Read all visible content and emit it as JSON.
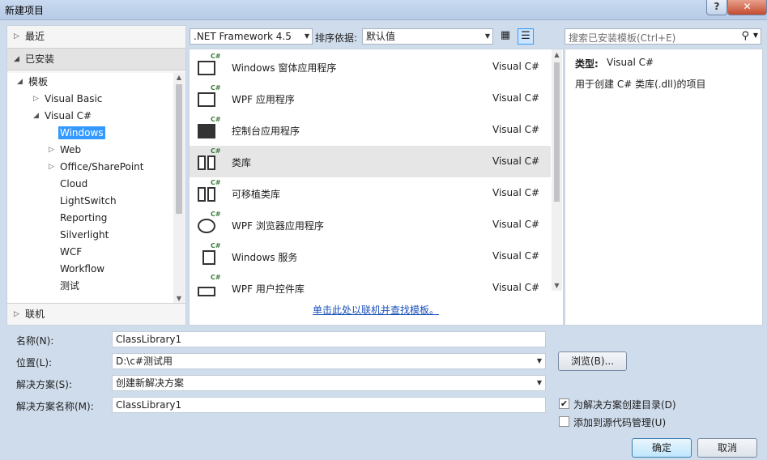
{
  "window": {
    "title": "新建项目",
    "help": "?",
    "close": "✕"
  },
  "sidebar": {
    "recent": "最近",
    "installed": "已安装",
    "online": "联机",
    "tree": [
      {
        "label": "模板",
        "toggle": "◢"
      },
      {
        "label": "Visual Basic",
        "toggle": "▷"
      },
      {
        "label": "Visual C#",
        "toggle": "◢"
      },
      {
        "label": "Windows",
        "selected": true
      },
      {
        "label": "Web",
        "toggle": "▷"
      },
      {
        "label": "Office/SharePoint",
        "toggle": "▷"
      },
      {
        "label": "Cloud"
      },
      {
        "label": "LightSwitch"
      },
      {
        "label": "Reporting"
      },
      {
        "label": "Silverlight"
      },
      {
        "label": "WCF"
      },
      {
        "label": "Workflow"
      },
      {
        "label": "测试"
      }
    ]
  },
  "toolbar": {
    "framework": ".NET Framework 4.5",
    "sort_label": "排序依据:",
    "sort_value": "默认值",
    "search_placeholder": "搜索已安装模板(Ctrl+E)"
  },
  "templates": [
    {
      "name": "Windows 窗体应用程序",
      "lang": "Visual C#"
    },
    {
      "name": "WPF 应用程序",
      "lang": "Visual C#"
    },
    {
      "name": "控制台应用程序",
      "lang": "Visual C#"
    },
    {
      "name": "类库",
      "lang": "Visual C#",
      "selected": true
    },
    {
      "name": "可移植类库",
      "lang": "Visual C#"
    },
    {
      "name": "WPF 浏览器应用程序",
      "lang": "Visual C#"
    },
    {
      "name": "Windows 服务",
      "lang": "Visual C#"
    },
    {
      "name": "WPF 用户控件库",
      "lang": "Visual C#"
    }
  ],
  "online_link": "单击此处以联机并查找模板。",
  "details": {
    "type_key": "类型:",
    "type_value": "Visual C#",
    "description": "用于创建 C# 类库(.dll)的项目"
  },
  "form": {
    "name_label": "名称(N):",
    "name_value": "ClassLibrary1",
    "location_label": "位置(L):",
    "location_value": "D:\\c#测试用",
    "solution_label": "解决方案(S):",
    "solution_value": "创建新解决方案",
    "solution_name_label": "解决方案名称(M):",
    "solution_name_value": "ClassLibrary1",
    "browse": "浏览(B)...",
    "create_dir_label": "为解决方案创建目录(D)",
    "create_dir_checked": true,
    "source_control_label": "添加到源代码管理(U)",
    "source_control_checked": false
  },
  "buttons": {
    "ok": "确定",
    "cancel": "取消"
  }
}
